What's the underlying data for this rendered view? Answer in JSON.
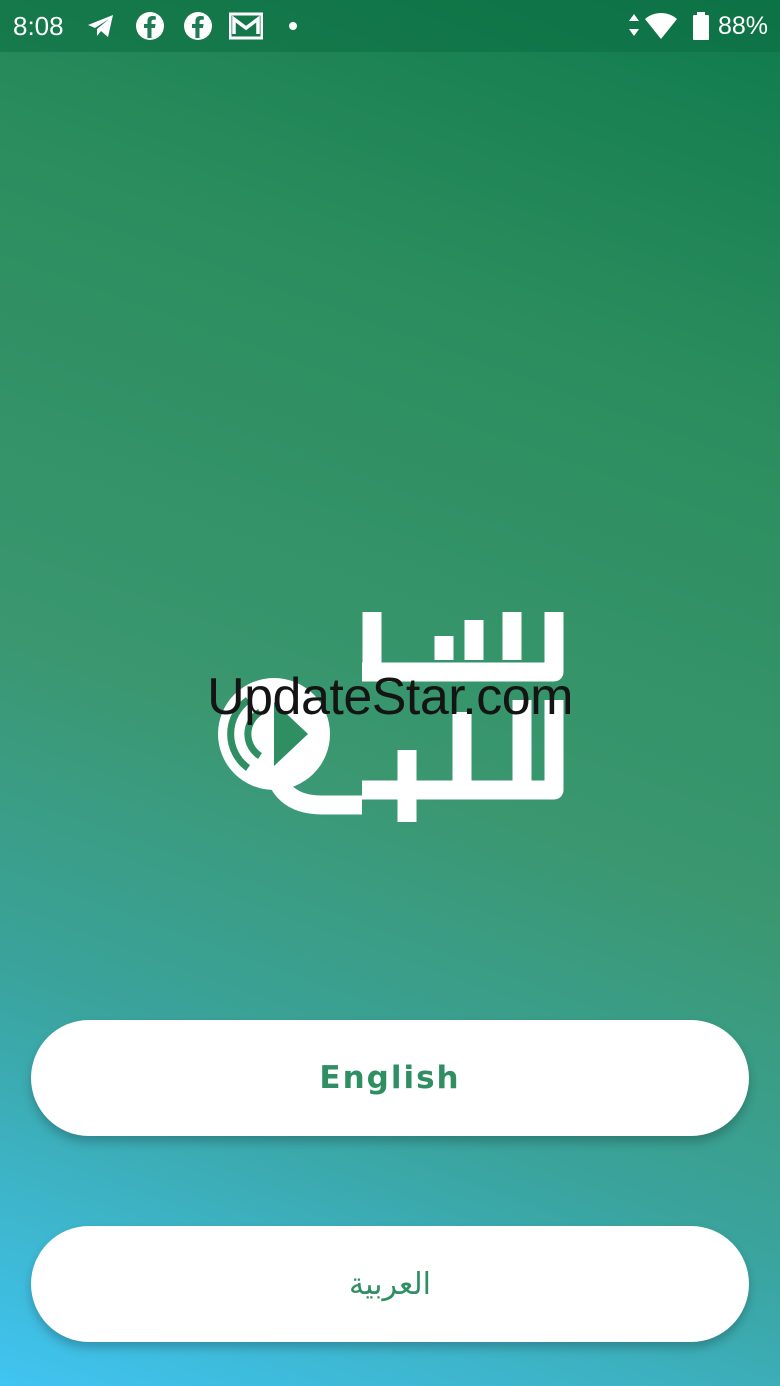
{
  "status_bar": {
    "time": "8:08",
    "notification_icons": [
      "telegram-icon",
      "facebook-icon",
      "facebook-icon",
      "gmail-icon",
      "dot-icon"
    ],
    "system_icons": [
      "data-arrows-icon",
      "wifi-icon",
      "battery-icon"
    ],
    "battery_percent": "88%"
  },
  "logo": {
    "name": "app-logo",
    "colors": {
      "fill": "#ffffff"
    }
  },
  "watermark": {
    "text": "UpdateStar.com"
  },
  "language_buttons": {
    "english_label": "English",
    "arabic_label": "العربية"
  },
  "colors": {
    "gradient_top": "#0f7a4c",
    "gradient_mid": "#3a9770",
    "gradient_bottom": "#40c4f2",
    "button_bg": "#ffffff",
    "button_text": "#2f8f63"
  }
}
